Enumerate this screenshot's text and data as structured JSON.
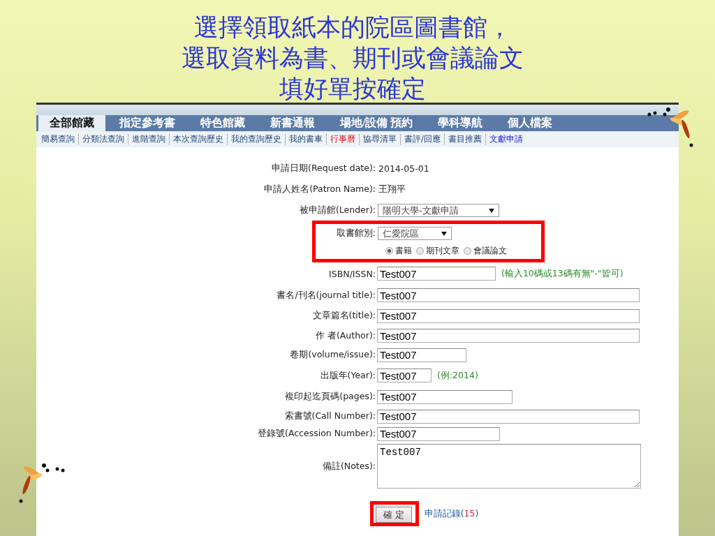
{
  "slide": {
    "title_lines": [
      "選擇領取紙本的院區圖書館，",
      "選取資料為書、期刊或會議論文",
      "填好單按確定"
    ]
  },
  "tabs": [
    {
      "label": "全部館藏",
      "selected": true
    },
    {
      "label": "指定參考書",
      "selected": false
    },
    {
      "label": "特色館藏",
      "selected": false
    },
    {
      "label": "新書通報",
      "selected": false
    },
    {
      "label": "場地/設備 預約",
      "selected": false
    },
    {
      "label": "學科導航",
      "selected": false
    },
    {
      "label": "個人檔案",
      "selected": false
    }
  ],
  "subnav": [
    {
      "label": "簡易查詢",
      "kind": "normal"
    },
    {
      "label": "分類法查詢",
      "kind": "normal"
    },
    {
      "label": "進階查詢",
      "kind": "normal"
    },
    {
      "label": "本次查詢歷史",
      "kind": "normal"
    },
    {
      "label": "我的查詢歷史",
      "kind": "normal"
    },
    {
      "label": "我的書車",
      "kind": "normal"
    },
    {
      "label": "行事曆",
      "kind": "event"
    },
    {
      "label": "協尋清單",
      "kind": "normal"
    },
    {
      "label": "書評/回應",
      "kind": "normal"
    },
    {
      "label": "書目推薦",
      "kind": "normal"
    },
    {
      "label": "文獻申請",
      "kind": "current"
    }
  ],
  "form": {
    "fields": [
      {
        "kind": "static",
        "label": "申請日期(Request date):",
        "value": "2014-05-01"
      },
      {
        "kind": "static",
        "label": "申請人姓名(Patron Name):",
        "value": "王翔平"
      },
      {
        "kind": "select",
        "label": "被申請館(Lender):",
        "value": "陽明大學-文獻申請"
      },
      {
        "kind": "select",
        "label": "取書館別:",
        "value": "仁愛院區",
        "highlighted": true
      },
      {
        "kind": "radios",
        "options": [
          {
            "label": "書籍",
            "selected": true
          },
          {
            "label": "期刊文章",
            "selected": false
          },
          {
            "label": "會議論文",
            "selected": false
          }
        ],
        "highlighted": true
      },
      {
        "kind": "text",
        "label": "ISBN/ISSN:",
        "value": "Test007",
        "hint": "(輸入10碼或13碼有無\"-\"皆可)"
      },
      {
        "kind": "text",
        "label": "書名/刊名(journal title):",
        "value": "Test007"
      },
      {
        "kind": "text",
        "label": "文章篇名(title):",
        "value": "Test007"
      },
      {
        "kind": "text",
        "label": "作 者(Author):",
        "value": "Test007"
      },
      {
        "kind": "text",
        "label": "卷期(volume/issue):",
        "value": "Test007"
      },
      {
        "kind": "text",
        "label": "出版年(Year):",
        "value": "Test007",
        "hint": "(例:2014)"
      },
      {
        "kind": "text",
        "label": "複印起迄頁碼(pages):",
        "value": "Test007"
      },
      {
        "kind": "text",
        "label": "索書號(Call Number):",
        "value": "Test007"
      },
      {
        "kind": "text",
        "label": "登錄號(Accession Number):",
        "value": "Test007"
      },
      {
        "kind": "textarea",
        "label": "備註(Notes):",
        "value": "Test007"
      }
    ],
    "submit": {
      "label": "確 定",
      "highlighted": true
    },
    "records_link": {
      "label": "申請記錄(",
      "count": "15",
      "suffix": ")"
    }
  }
}
